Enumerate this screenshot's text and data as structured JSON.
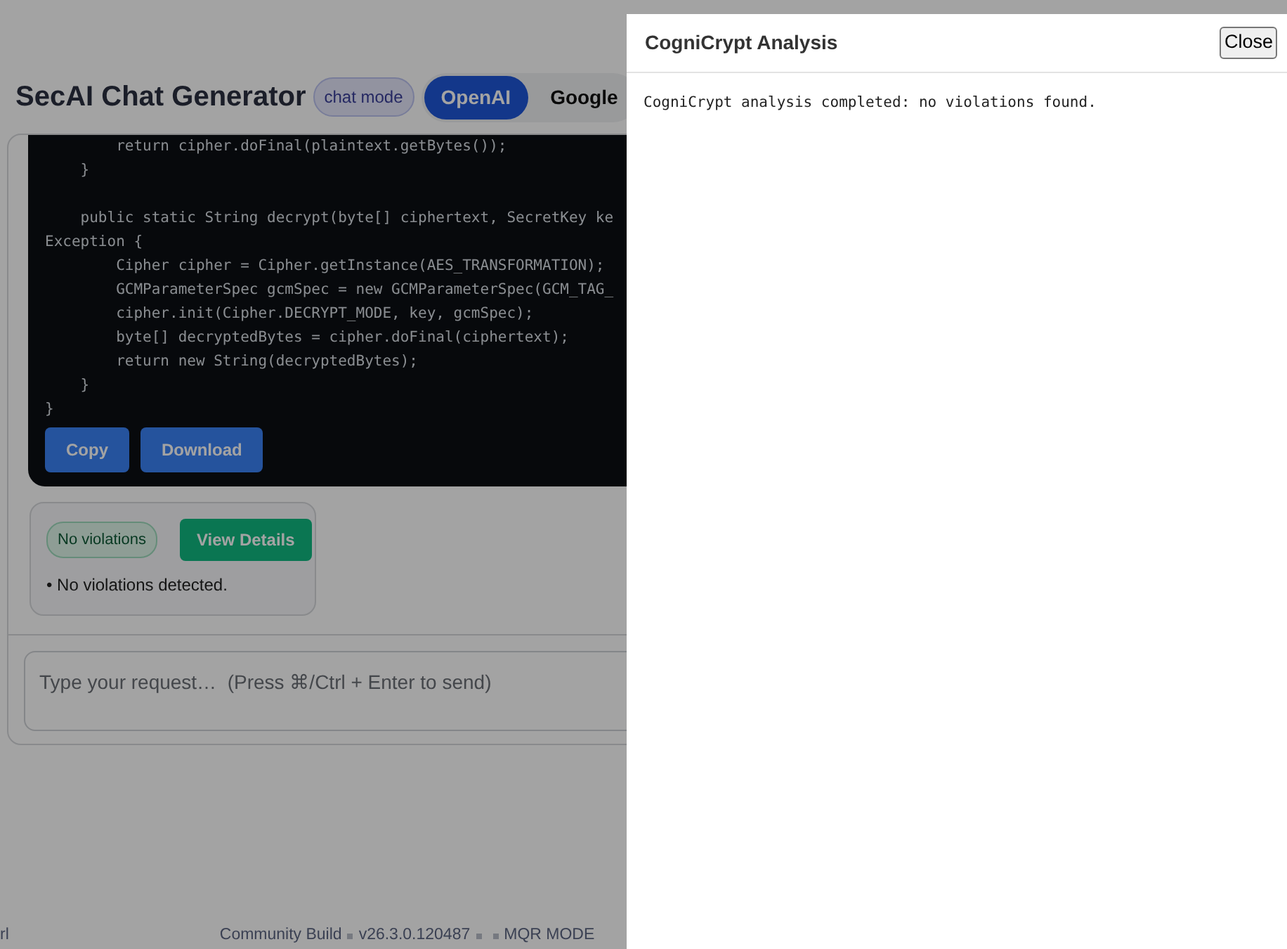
{
  "header": {
    "title": "SecAI Chat Generator",
    "mode_badge": "chat mode",
    "providers": [
      {
        "label": "OpenAI",
        "selected": true
      },
      {
        "label": "Google",
        "selected": false
      }
    ]
  },
  "code_block": {
    "lines": [
      {
        "text": "        return cipher.doFinal(plaintext.getBytes());"
      },
      {
        "text": "    }"
      },
      {
        "text": "    public static String decrypt(byte[] ciphertext, SecretKey ke",
        "blank_before": true
      },
      {
        "text": "Exception {"
      },
      {
        "text": "        Cipher cipher = Cipher.getInstance(AES_TRANSFORMATION);"
      },
      {
        "text": "        GCMParameterSpec gcmSpec = new GCMParameterSpec(GCM_TAG_"
      },
      {
        "text": "        cipher.init(Cipher.DECRYPT_MODE, key, gcmSpec);"
      },
      {
        "text": "        byte[] decryptedBytes = cipher.doFinal(ciphertext);"
      },
      {
        "text": "        return new String(decryptedBytes);"
      },
      {
        "text": "    }"
      },
      {
        "text": "}"
      }
    ],
    "buttons": [
      "Copy",
      "Download"
    ]
  },
  "analysis_card": {
    "status_badge": "No violations",
    "button": "View Details",
    "findings": [
      "• No violations detected."
    ]
  },
  "composer": {
    "placeholder": "Type your request…  (Press ⌘/Ctrl + Enter to send)"
  },
  "footer": {
    "left_fragment": "rl",
    "build": "Community Build",
    "version": "v26.3.0.120487",
    "mode": "MQR MODE"
  },
  "side_panel": {
    "title": "CogniCrypt Analysis",
    "close_button": "Close",
    "message": "CogniCrypt analysis completed: no violations found."
  }
}
